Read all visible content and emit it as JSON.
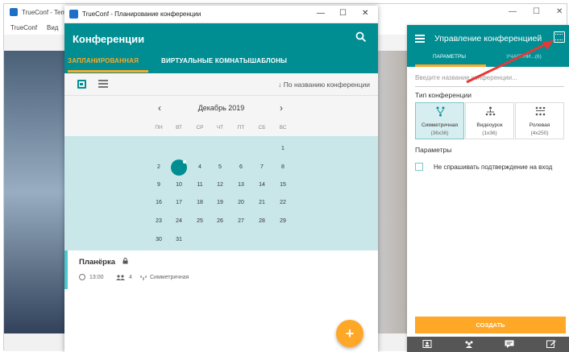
{
  "background_app": {
    "title": "TrueConf - Tem",
    "menu": [
      "TrueConf",
      "Вид"
    ],
    "window_controls": [
      "—",
      "☐",
      "✕"
    ]
  },
  "planner": {
    "window_title": "TrueConf - Планирование конференции",
    "window_controls": [
      "—",
      "☐",
      "✕"
    ],
    "header_title": "Конференции",
    "tabs": [
      {
        "label": "ЗАПЛАНИРОВАННАЯ",
        "active": true
      },
      {
        "label": "ВИРТУАЛЬНЫЕ КОМНАТЫ",
        "active": false
      },
      {
        "label": "ШАБЛОНЫ",
        "active": false
      }
    ],
    "sort_label": "↓  По названию конференции",
    "calendar": {
      "month": "Декабрь 2019",
      "prev": "‹",
      "next": "›",
      "weekdays": [
        "ПН",
        "ВТ",
        "СР",
        "ЧТ",
        "ПТ",
        "СБ",
        "ВС"
      ],
      "today": "3"
    },
    "event": {
      "title": "Планёрка",
      "time": "13:00",
      "participants": "4",
      "type": "Симметричная"
    },
    "fab_label": "+"
  },
  "manager": {
    "title": "Управление конференцией",
    "tabs": [
      {
        "label": "ПАРАМЕТРЫ",
        "active": true
      },
      {
        "label": "УЧАСТНИ...(6)",
        "active": false
      }
    ],
    "name_placeholder": "Введите название конференции...",
    "type_label": "Тип конференции",
    "types": [
      {
        "name": "Симметричная",
        "size": "(36x36)",
        "selected": true
      },
      {
        "name": "Видеоурок",
        "size": "(1x36)",
        "selected": false
      },
      {
        "name": "Ролевая",
        "size": "(4x250)",
        "selected": false
      }
    ],
    "params_label": "Параметры",
    "checkbox_label": "Не спрашивать подтверждение на вход",
    "create_label": "СОЗДАТЬ"
  },
  "colors": {
    "teal": "#008e93",
    "orange": "#ffa726",
    "arrow": "#e53935"
  }
}
